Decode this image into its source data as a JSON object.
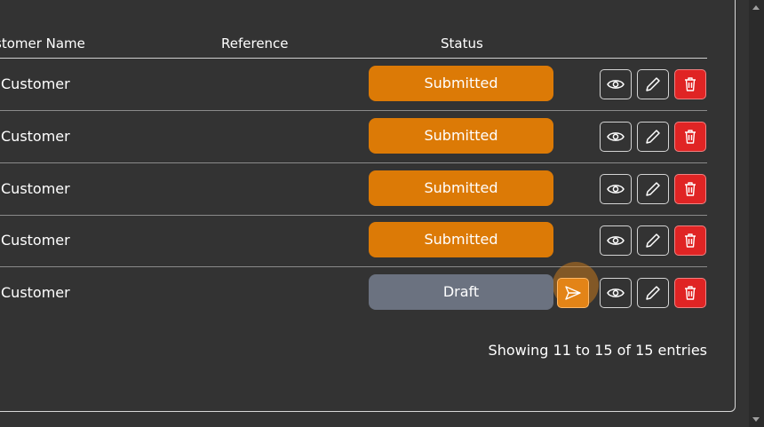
{
  "table": {
    "headers": {
      "customer_name": "stomer Name",
      "reference": "Reference",
      "status": "Status"
    },
    "rows": [
      {
        "customer": "Customer",
        "reference": "",
        "status": "Submitted",
        "status_color": "#dc7a06"
      },
      {
        "customer": "Customer",
        "reference": "",
        "status": "Submitted",
        "status_color": "#dc7a06"
      },
      {
        "customer": "Customer",
        "reference": "",
        "status": "Submitted",
        "status_color": "#dc7a06"
      },
      {
        "customer": "Customer",
        "reference": "",
        "status": "Submitted",
        "status_color": "#dc7a06"
      },
      {
        "customer": "Customer",
        "reference": "",
        "status": "Draft",
        "status_color": "#6b7280"
      }
    ],
    "actions": {
      "view_icon": "eye-icon",
      "edit_icon": "pencil-icon",
      "delete_icon": "trash-icon",
      "submit_icon": "send-icon"
    }
  },
  "footer": {
    "entries_info": "Showing 11 to 15 of 15 entries"
  },
  "colors": {
    "background": "#333333",
    "submitted": "#dc7a06",
    "draft": "#6b7280",
    "delete": "#e02424",
    "submit_action": "#e38417"
  }
}
